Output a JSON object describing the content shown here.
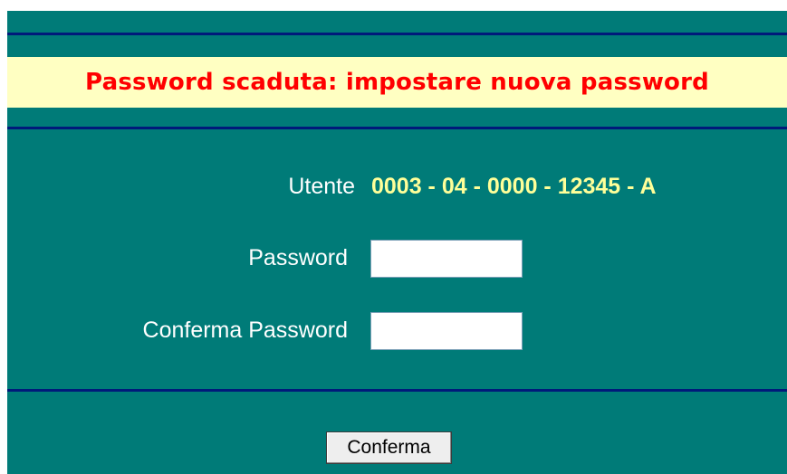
{
  "banner": {
    "message": "Password scaduta: impostare nuova password"
  },
  "user": {
    "label": "Utente",
    "value": "0003 - 04 - 0000 - 12345 - A"
  },
  "password": {
    "label": "Password",
    "value": ""
  },
  "confirm_password": {
    "label": "Conferma Password",
    "value": ""
  },
  "actions": {
    "confirm_label": "Conferma"
  },
  "colors": {
    "background": "#007b78",
    "rule": "#001a7a",
    "banner_background": "#ffffc2",
    "banner_text": "#ff0000",
    "user_value": "#ffff99"
  }
}
